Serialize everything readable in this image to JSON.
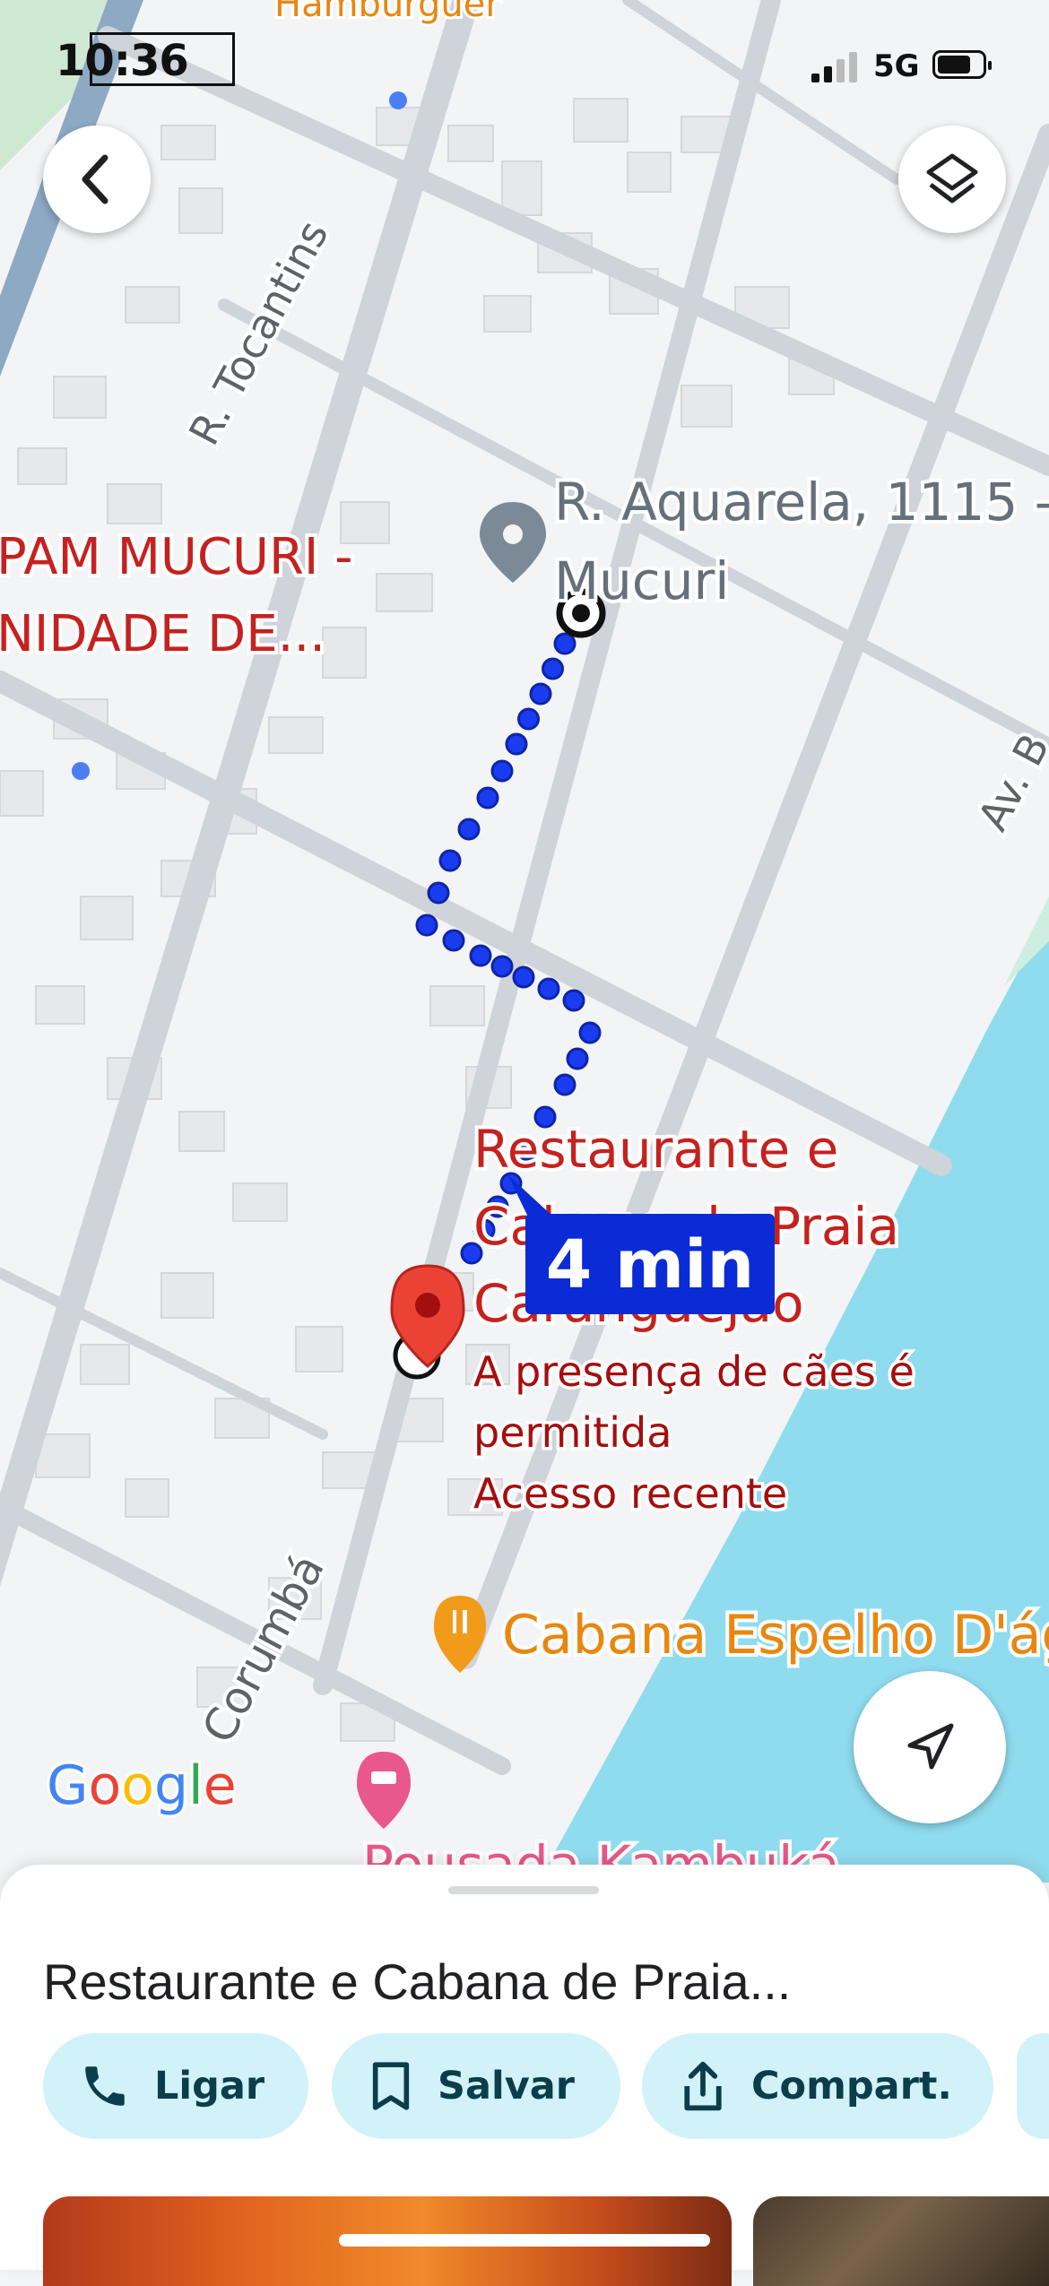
{
  "status_bar": {
    "time": "10:36",
    "network": "5G",
    "battery_percent": 70
  },
  "map": {
    "streets": [
      "R. Tocantins",
      "Corumbá",
      "Av. B"
    ],
    "top_partial_label": "Hamburguer",
    "destination_pin_label": [
      "R. Aquarela, 1115 -",
      "Mucuri"
    ],
    "poi_left_label": [
      "PAM MUCURI -",
      "NIDADE DE..."
    ],
    "restaurant_label": [
      "Restaurante e",
      "Cabana de Praia",
      "Caranguejão"
    ],
    "restaurant_details": [
      "A presença de cães é",
      "permitida",
      "Acesso recente"
    ],
    "eta": "4 min",
    "poi_cabana": "Cabana Espelho D'água",
    "poi_bottom": "Pousada Kambuká",
    "attribution": "Google",
    "colors": {
      "route": "#1a3cf0",
      "eta_bg": "#0a2bd6",
      "water": "#8fdcef",
      "restaurant_text": "#c5221f",
      "food_poi": "#e8870f",
      "lodging_poi": "#e8588a"
    }
  },
  "buttons": {
    "back_icon": "chevron-left-icon",
    "layers_icon": "layers-icon",
    "locate_icon": "navigation-arrow-icon"
  },
  "sheet": {
    "title": "Restaurante e Cabana de Praia...",
    "actions": [
      {
        "label": "Ligar",
        "icon": "phone-icon"
      },
      {
        "label": "Salvar",
        "icon": "bookmark-icon"
      },
      {
        "label": "Compart.",
        "icon": "share-icon"
      }
    ]
  }
}
